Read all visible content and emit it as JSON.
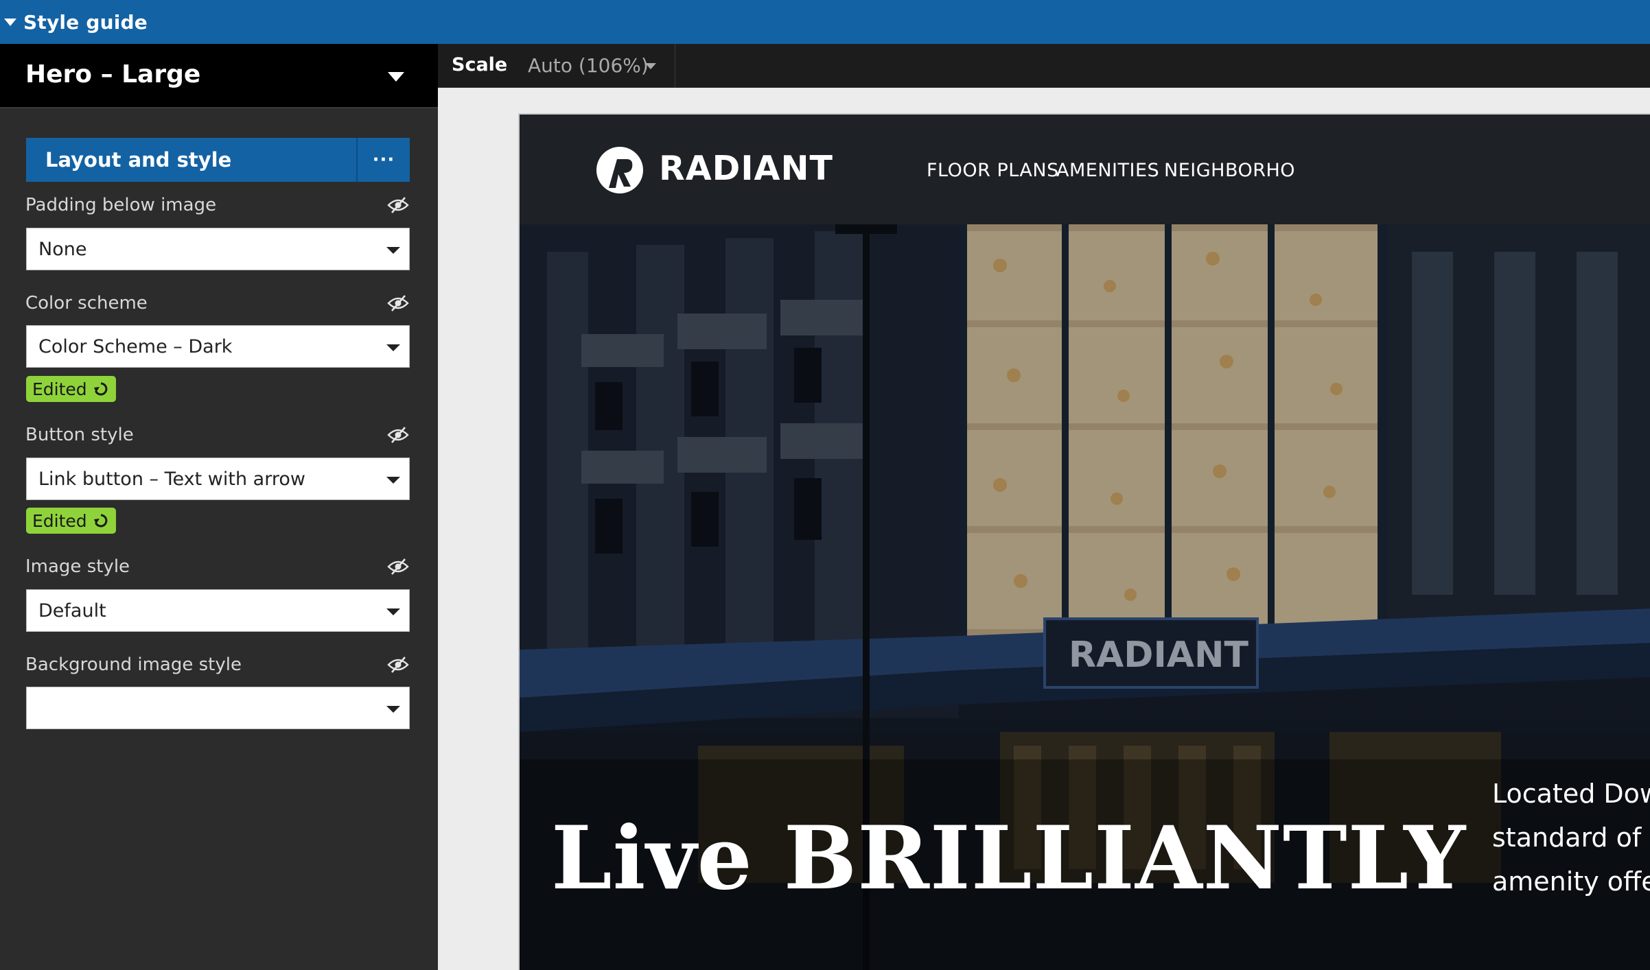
{
  "app": {
    "title": "Style guide"
  },
  "sidebar": {
    "component_name": "Hero – Large",
    "section": {
      "label": "Layout and style",
      "more_label": "···"
    },
    "fields": [
      {
        "label": "Padding below image",
        "value": "None"
      },
      {
        "label": "Color scheme",
        "value": "Color Scheme – Dark",
        "badge": "Edited"
      },
      {
        "label": "Button style",
        "value": "Link button – Text with arrow",
        "badge": "Edited"
      },
      {
        "label": "Image style",
        "value": "Default"
      },
      {
        "label": "Background image style",
        "value": ""
      }
    ]
  },
  "toolbar": {
    "scale_label": "Scale",
    "scale_value": "Auto (106%)"
  },
  "preview": {
    "logo": "RADIANT",
    "nav": [
      "FLOOR PLANS",
      "AMENITIES",
      "NEIGHBORHO"
    ],
    "sign_text": "RADIANT",
    "hero_title": "Live BRILLIANTLY",
    "hero_desc": [
      "Located Dow",
      "standard of a",
      "amenity offe"
    ]
  },
  "colors": {
    "topbar": "#1362a4",
    "badge": "#8fd33a",
    "sidebar": "#2c2c2c"
  }
}
